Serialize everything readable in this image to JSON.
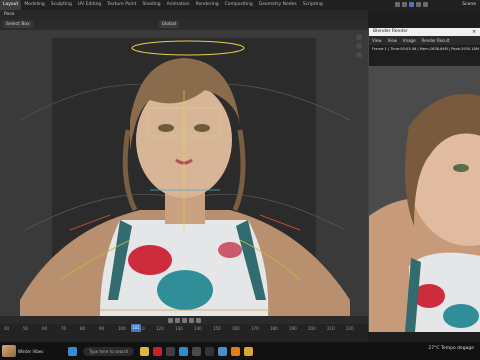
{
  "workspace_tabs": [
    "Layout",
    "Modeling",
    "Sculpting",
    "UV Editing",
    "Texture Paint",
    "Shading",
    "Animation",
    "Rendering",
    "Compositing",
    "Geometry Nodes",
    "Scripting"
  ],
  "active_tab_index": 0,
  "scene_label": "Scene",
  "editor_mode": "Pose",
  "header": {
    "select_box": "Select Box",
    "orientation": "Global"
  },
  "timeline": {
    "frame_marks": [
      "40",
      "50",
      "60",
      "70",
      "80",
      "90",
      "100",
      "110",
      "120",
      "130",
      "140",
      "150",
      "160",
      "170",
      "180",
      "190",
      "200",
      "210",
      "220"
    ],
    "current_frame": "101"
  },
  "render_window": {
    "title": "Blender Render",
    "close": "×",
    "menu": [
      "View",
      "View",
      "Image",
      "Render Result"
    ],
    "info": "Frame:1 | Time:00:03.06 | Mem:2638.64M | Peak:2930.18M"
  },
  "taskbar": {
    "weather_label": "Winter Vibes",
    "search_placeholder": "Type here to search",
    "tray_text": "27°C  Tempo degage"
  },
  "colors": {
    "accent": "#4a78c0",
    "panel": "#2b2b2b"
  }
}
